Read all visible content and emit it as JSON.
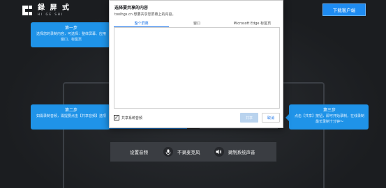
{
  "brand": {
    "title": "録 屏 式",
    "subtitle": "HI GE SHI"
  },
  "header": {
    "download_label": "下载客户端"
  },
  "steps": [
    {
      "title": "第一步",
      "body": "选择您的录制内容，可选择：整体屏幕、应用窗口、标签页"
    },
    {
      "title": "第二步",
      "body": "如需录制音频，需提要点击【共享音频】选项"
    },
    {
      "title": "第三步",
      "body": "点击【共享】按钮，即可开始录制，在线录制最长录制十分钟～"
    }
  ],
  "dialog": {
    "title": "选择要共享的内容",
    "subtitle": "toolhgs.cn 想要共享您屏幕上的内容。",
    "tabs": [
      {
        "label": "整个屏幕",
        "active": true
      },
      {
        "label": "窗口",
        "active": false
      },
      {
        "label": "Microsoft Edge 标签页",
        "active": false
      }
    ],
    "share_audio_label": "共享系统音频",
    "share_audio_checked": true,
    "share_button": "共享",
    "cancel_button": "取消"
  },
  "audio_bar": {
    "label": "设置音频",
    "mic_label": "不录麦克风",
    "system_label": "录制系统声音"
  },
  "colors": {
    "accent": "#1f93e8",
    "button_blue": "#1e8bf1",
    "background": "#1f2124"
  }
}
